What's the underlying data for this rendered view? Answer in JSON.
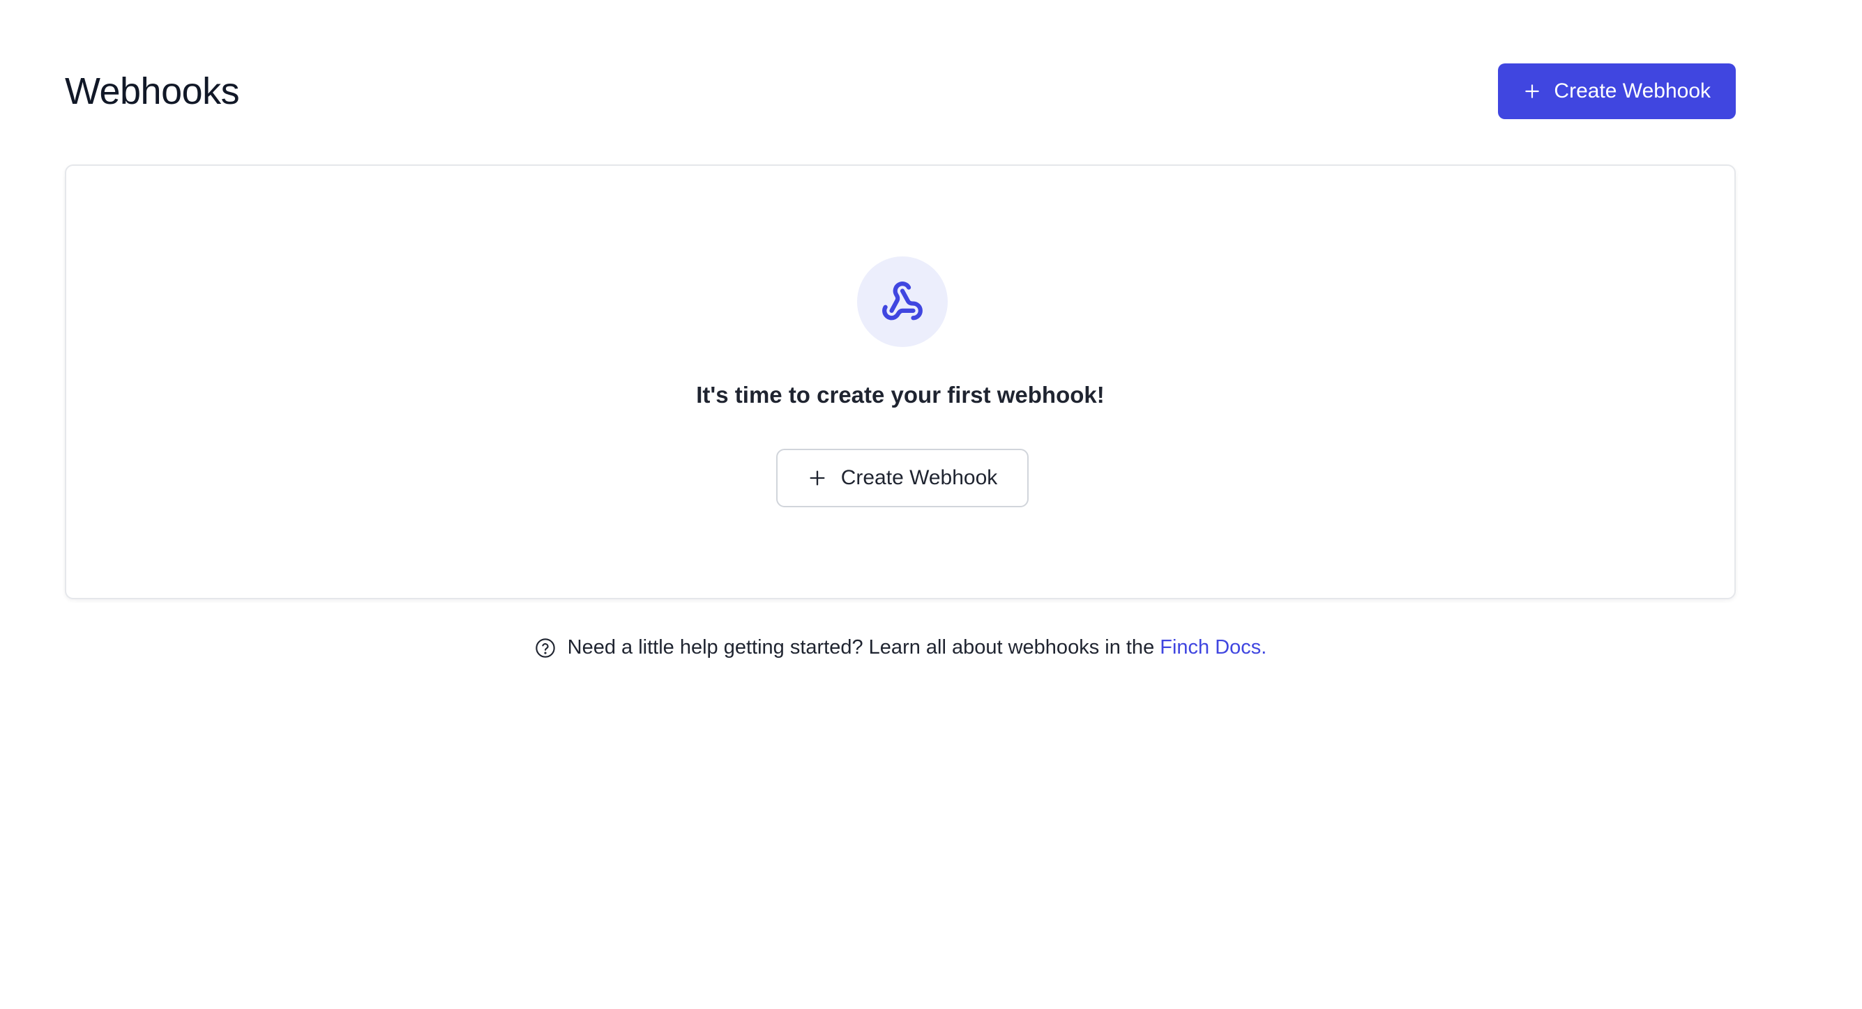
{
  "header": {
    "title": "Webhooks",
    "create_button_label": "Create Webhook"
  },
  "empty_state": {
    "icon": "webhook-icon",
    "heading": "It's time to create your first webhook!",
    "create_button_label": "Create Webhook"
  },
  "help": {
    "icon": "question-circle-icon",
    "text": "Need a little help getting started? Learn all about webhooks in the",
    "link_text": "Finch Docs."
  },
  "colors": {
    "primary": "#4046e0",
    "icon_circle_bg": "#eceefc",
    "text": "#1f2430",
    "border": "#e5e7eb"
  }
}
